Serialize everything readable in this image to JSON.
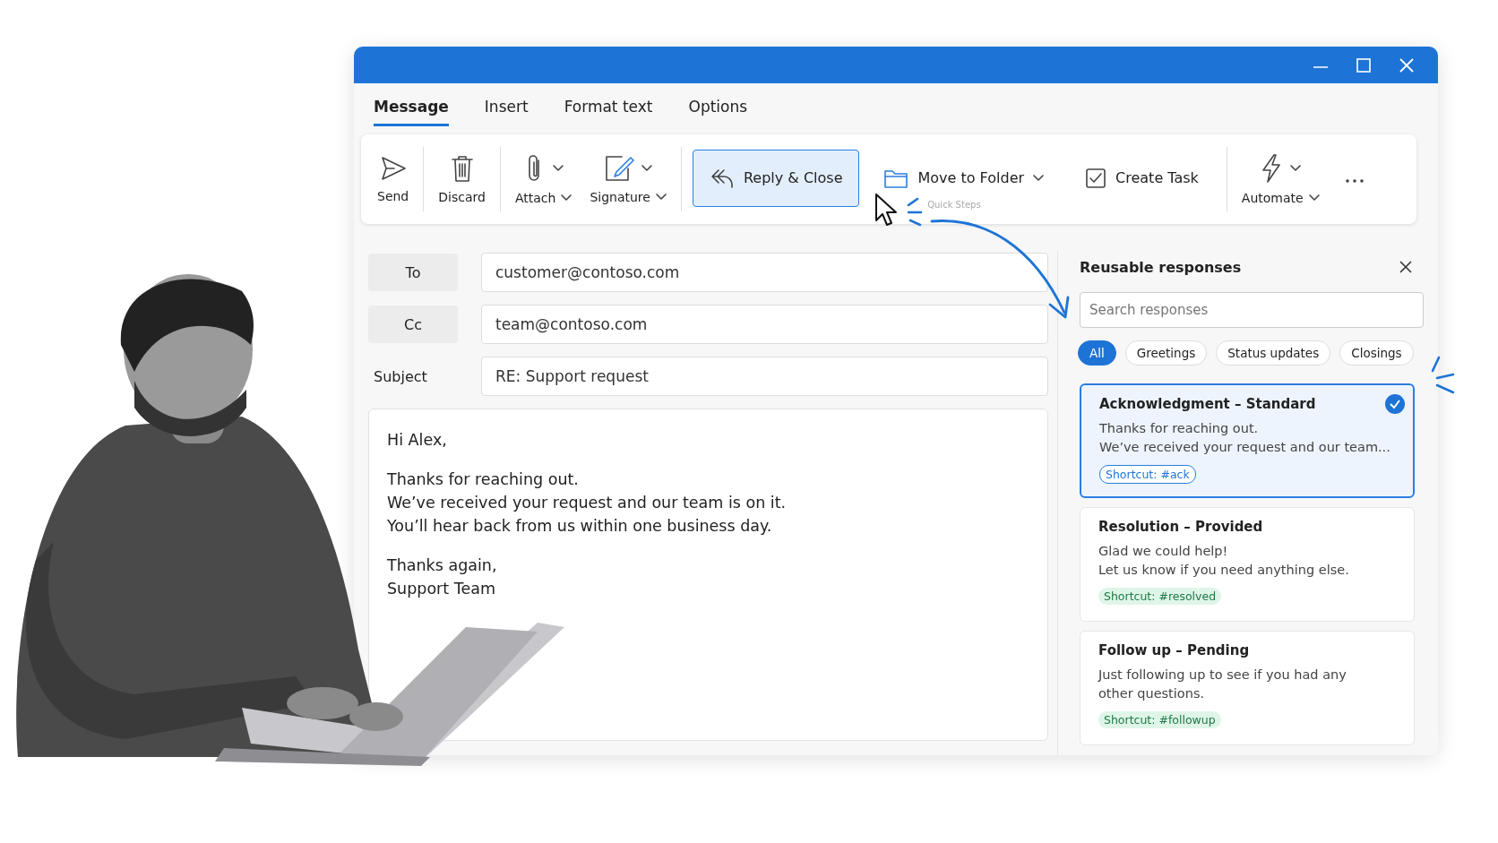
{
  "tabs": [
    {
      "label": "Message",
      "selected": true
    },
    {
      "label": "Insert",
      "selected": false
    },
    {
      "label": "Format text",
      "selected": false
    },
    {
      "label": "Options",
      "selected": false
    }
  ],
  "ribbon": [
    {
      "kind": "large",
      "label": "Send",
      "menu": false
    },
    {
      "kind": "large",
      "label": "Discard",
      "menu": false
    },
    {
      "kind": "large",
      "label": "Attach",
      "menu": true
    },
    {
      "kind": "large",
      "label": "Signature",
      "menu": true
    },
    {
      "kind": "quick",
      "label": "Quick Steps",
      "items": [
        {
          "label": "Reply & Close",
          "menu": false,
          "selected": true
        },
        {
          "label": "Move to Folder",
          "menu": true,
          "selected": false
        },
        {
          "label": "Create Task",
          "menu": false,
          "selected": false
        }
      ]
    },
    {
      "kind": "large",
      "label": "Automate",
      "menu": true
    },
    {
      "kind": "more"
    }
  ],
  "fields": [
    {
      "label": "To",
      "value": "customer@contoso.com",
      "boxed": true
    },
    {
      "label": "Cc",
      "value": "team@contoso.com",
      "boxed": true
    },
    {
      "label": "Subject",
      "value": "RE: Support request",
      "boxed": false
    }
  ],
  "body": [
    [
      "Hi Alex,"
    ],
    [
      "Thanks for reaching out.",
      "We’ve received your request and our team is on it.",
      "You’ll hear back from us within one business day."
    ],
    [
      "Thanks again,",
      "Support Team"
    ]
  ],
  "panel": {
    "title": "Reusable responses",
    "search": {
      "placeholder": "Search responses"
    },
    "filters": [
      {
        "label": "All",
        "selected": true
      },
      {
        "label": "Greetings",
        "selected": false
      },
      {
        "label": "Status updates",
        "selected": false
      },
      {
        "label": "Closings",
        "selected": false
      }
    ],
    "responses": [
      {
        "title": "Acknowledgment – Standard",
        "lines": [
          "Thanks for reaching out.",
          "We’ve received your request and our team..."
        ],
        "shortcut": "Shortcut: #ack",
        "selected": true
      },
      {
        "title": "Resolution – Provided",
        "lines": [
          "Glad we could help!",
          "Let us know if you need anything else."
        ],
        "shortcut": "Shortcut: #resolved",
        "selected": false
      },
      {
        "title": "Follow up – Pending",
        "lines": [
          "Just following up to see if you had any",
          "other questions."
        ],
        "shortcut": "Shortcut: #followup",
        "selected": false
      }
    ]
  },
  "person": {
    "kind": "picture"
  }
}
